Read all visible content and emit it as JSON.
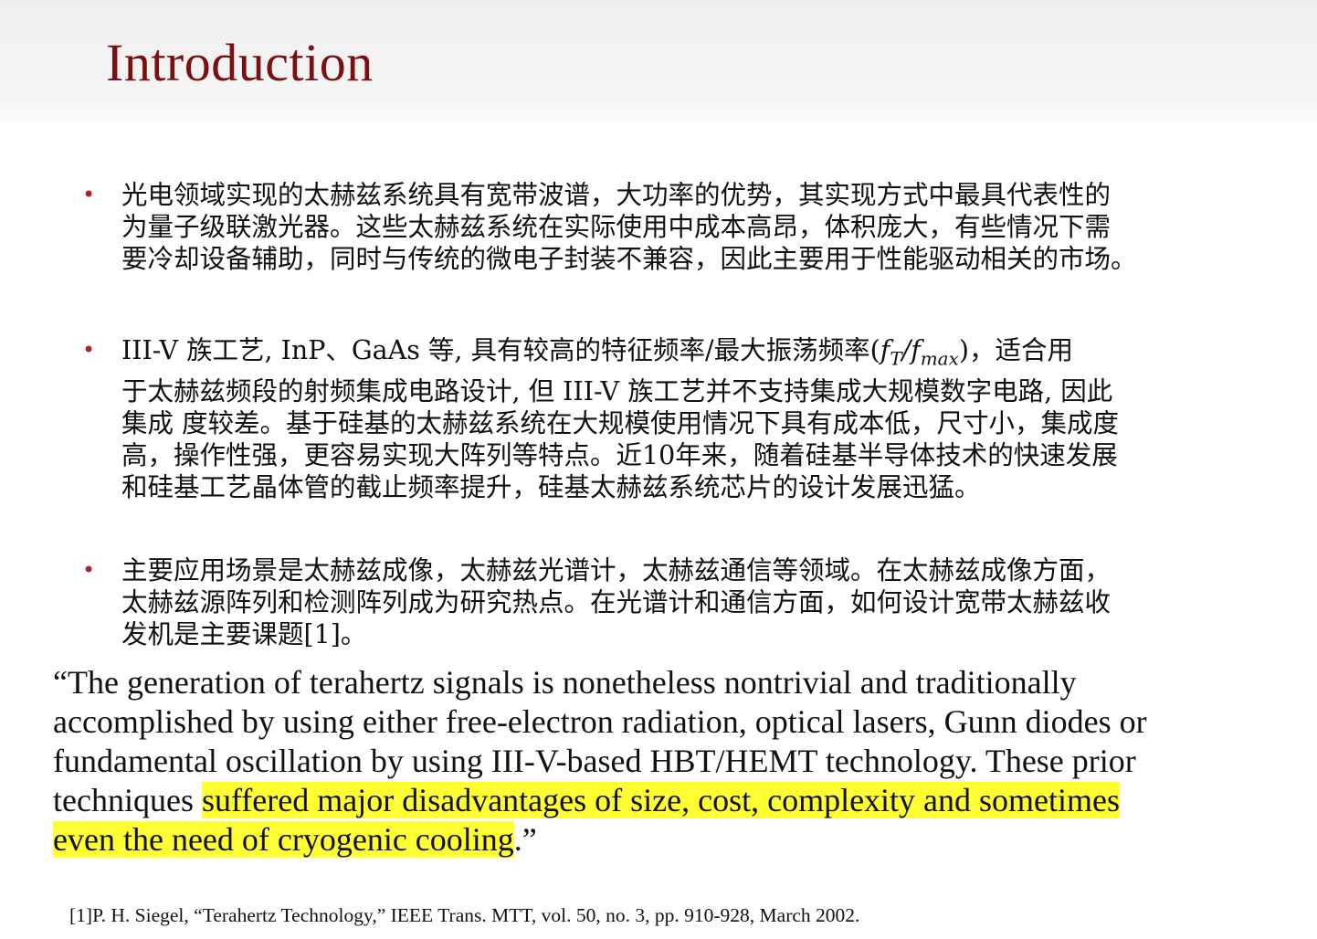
{
  "slide": {
    "title": "Introduction",
    "bullets": [
      {
        "text": "光电领域实现的太赫兹系统具有宽带波谱，大功率的优势，其实现方式中最具代表性的\n为量子级联激光器。这些太赫兹系统在实际使用中成本高昂，体积庞大，有些情况下需\n要冷却设备辅助，同时与传统的微电子封装不兼容，因此主要用于性能驱动相关的市场。"
      },
      {
        "text_before_math": "III-V  族工艺, InP、GaAs 等, 具有较高的特征频率/最大振荡频率(",
        "math": "fT/fmax",
        "text_after_math": ")，适合用\n于太赫兹频段的射频集成电路设计, 但  III-V 族工艺并不支持集成大规模数字电路, 因此\n集成  度较差。基于硅基的太赫兹系统在大规模使用情况下具有成本低，尺寸小，集成度\n高，操作性强，更容易实现大阵列等特点。近10年来，随着硅基半导体技术的快速发展\n和硅基工艺晶体管的截止频率提升，硅基太赫兹系统芯片的设计发展迅猛。"
      },
      {
        "text": "主要应用场景是太赫兹成像，太赫兹光谱计，太赫兹通信等领域。在太赫兹成像方面，\n太赫兹源阵列和检测阵列成为研究热点。在光谱计和通信方面，如何设计宽带太赫兹收\n发机是主要课题[1]。"
      }
    ],
    "bullet_marker": "•",
    "quote": {
      "before_highlight": "“The generation of terahertz signals is nonetheless nontrivial and traditionally\naccomplished by using either free-electron radiation, optical lasers, Gunn diodes or\nfundamental oscillation by using III-V-based HBT/HEMT technology. These prior\ntechniques ",
      "highlighted": "suffered major disadvantages of size, cost, complexity and sometimes \neven the need of cryogenic cooling",
      "after_highlight": ".”",
      "highlight_color": "#ffff33"
    },
    "reference": "[1]P. H. Siegel, “Terahertz Technology,” IEEE Trans. MTT, vol. 50, no. 3, pp. 910-928, March 2002.",
    "colors": {
      "title": "#7a1010",
      "bullet": "#b22222",
      "header_band": "#efefef"
    }
  }
}
